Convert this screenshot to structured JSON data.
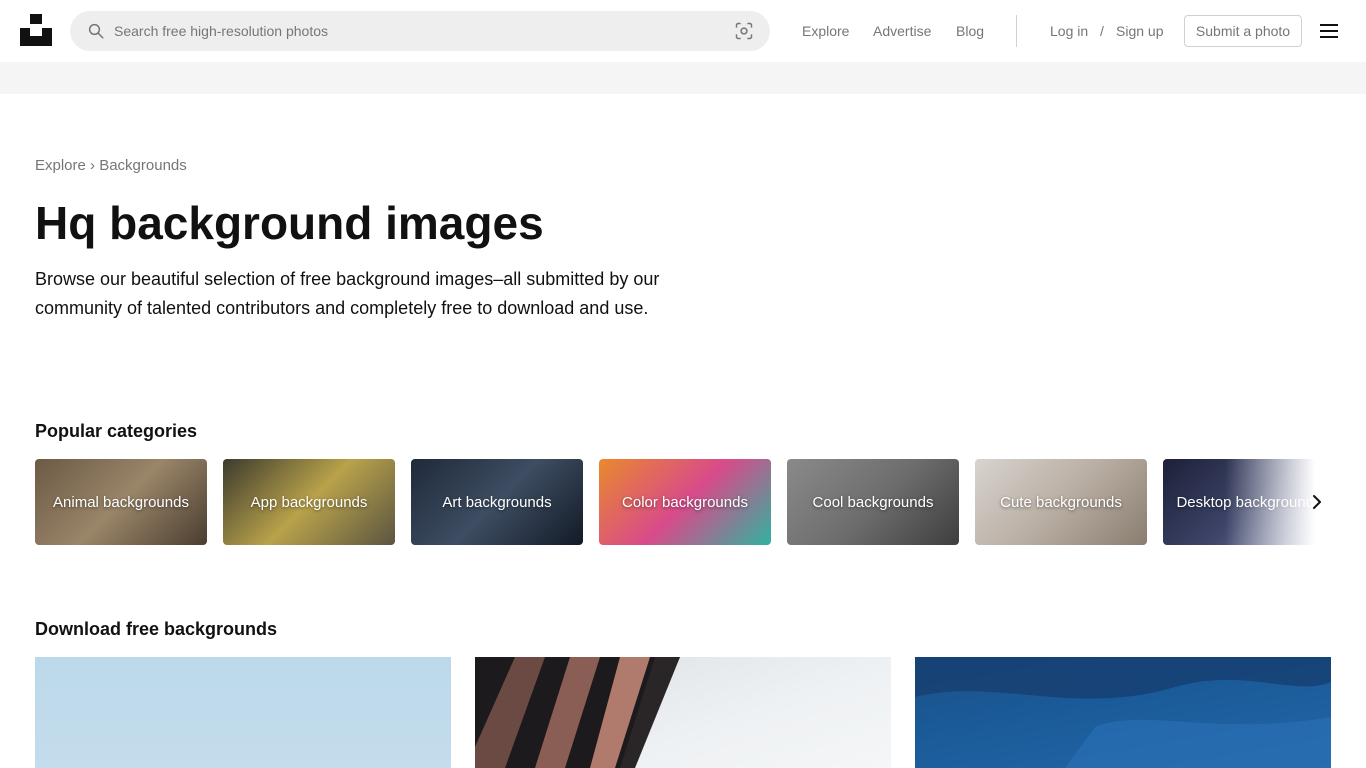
{
  "header": {
    "search_placeholder": "Search free high-resolution photos",
    "nav": {
      "explore": "Explore",
      "advertise": "Advertise",
      "blog": "Blog",
      "login": "Log in",
      "slash": "/",
      "signup": "Sign up",
      "submit": "Submit a photo"
    }
  },
  "breadcrumb": {
    "root": "Explore",
    "separator": "›",
    "current": "Backgrounds"
  },
  "hero": {
    "title": "Hq background images",
    "description": "Browse our beautiful selection of free background images–all submitted by our community of talented contributors and completely free to download and use."
  },
  "sections": {
    "popular": "Popular categories",
    "download": "Download free backgrounds"
  },
  "categories": [
    {
      "label": "Animal backgrounds",
      "colors": [
        "#6b5a45",
        "#9a8569",
        "#4a3d30"
      ]
    },
    {
      "label": "App backgrounds",
      "colors": [
        "#3b3a2e",
        "#b9a24a",
        "#5a5540"
      ]
    },
    {
      "label": "Art backgrounds",
      "colors": [
        "#1f2a3a",
        "#3e4d62",
        "#121a26"
      ]
    },
    {
      "label": "Color backgrounds",
      "colors": [
        "#e88a2c",
        "#d94a8a",
        "#2fb3a0"
      ]
    },
    {
      "label": "Cool backgrounds",
      "colors": [
        "#8a8a8a",
        "#6e6e6e",
        "#3e3e3e"
      ]
    },
    {
      "label": "Cute backgrounds",
      "colors": [
        "#d8d4cf",
        "#b9aea3",
        "#8a7d70"
      ]
    },
    {
      "label": "Desktop backgrounds",
      "colors": [
        "#1c2038",
        "#3d4468",
        "#8a8fae"
      ]
    }
  ],
  "colors": {
    "accent_text": "#111111",
    "muted_text": "#767676",
    "banner": "#f5f5f5",
    "search_bg": "#eeeeee"
  }
}
